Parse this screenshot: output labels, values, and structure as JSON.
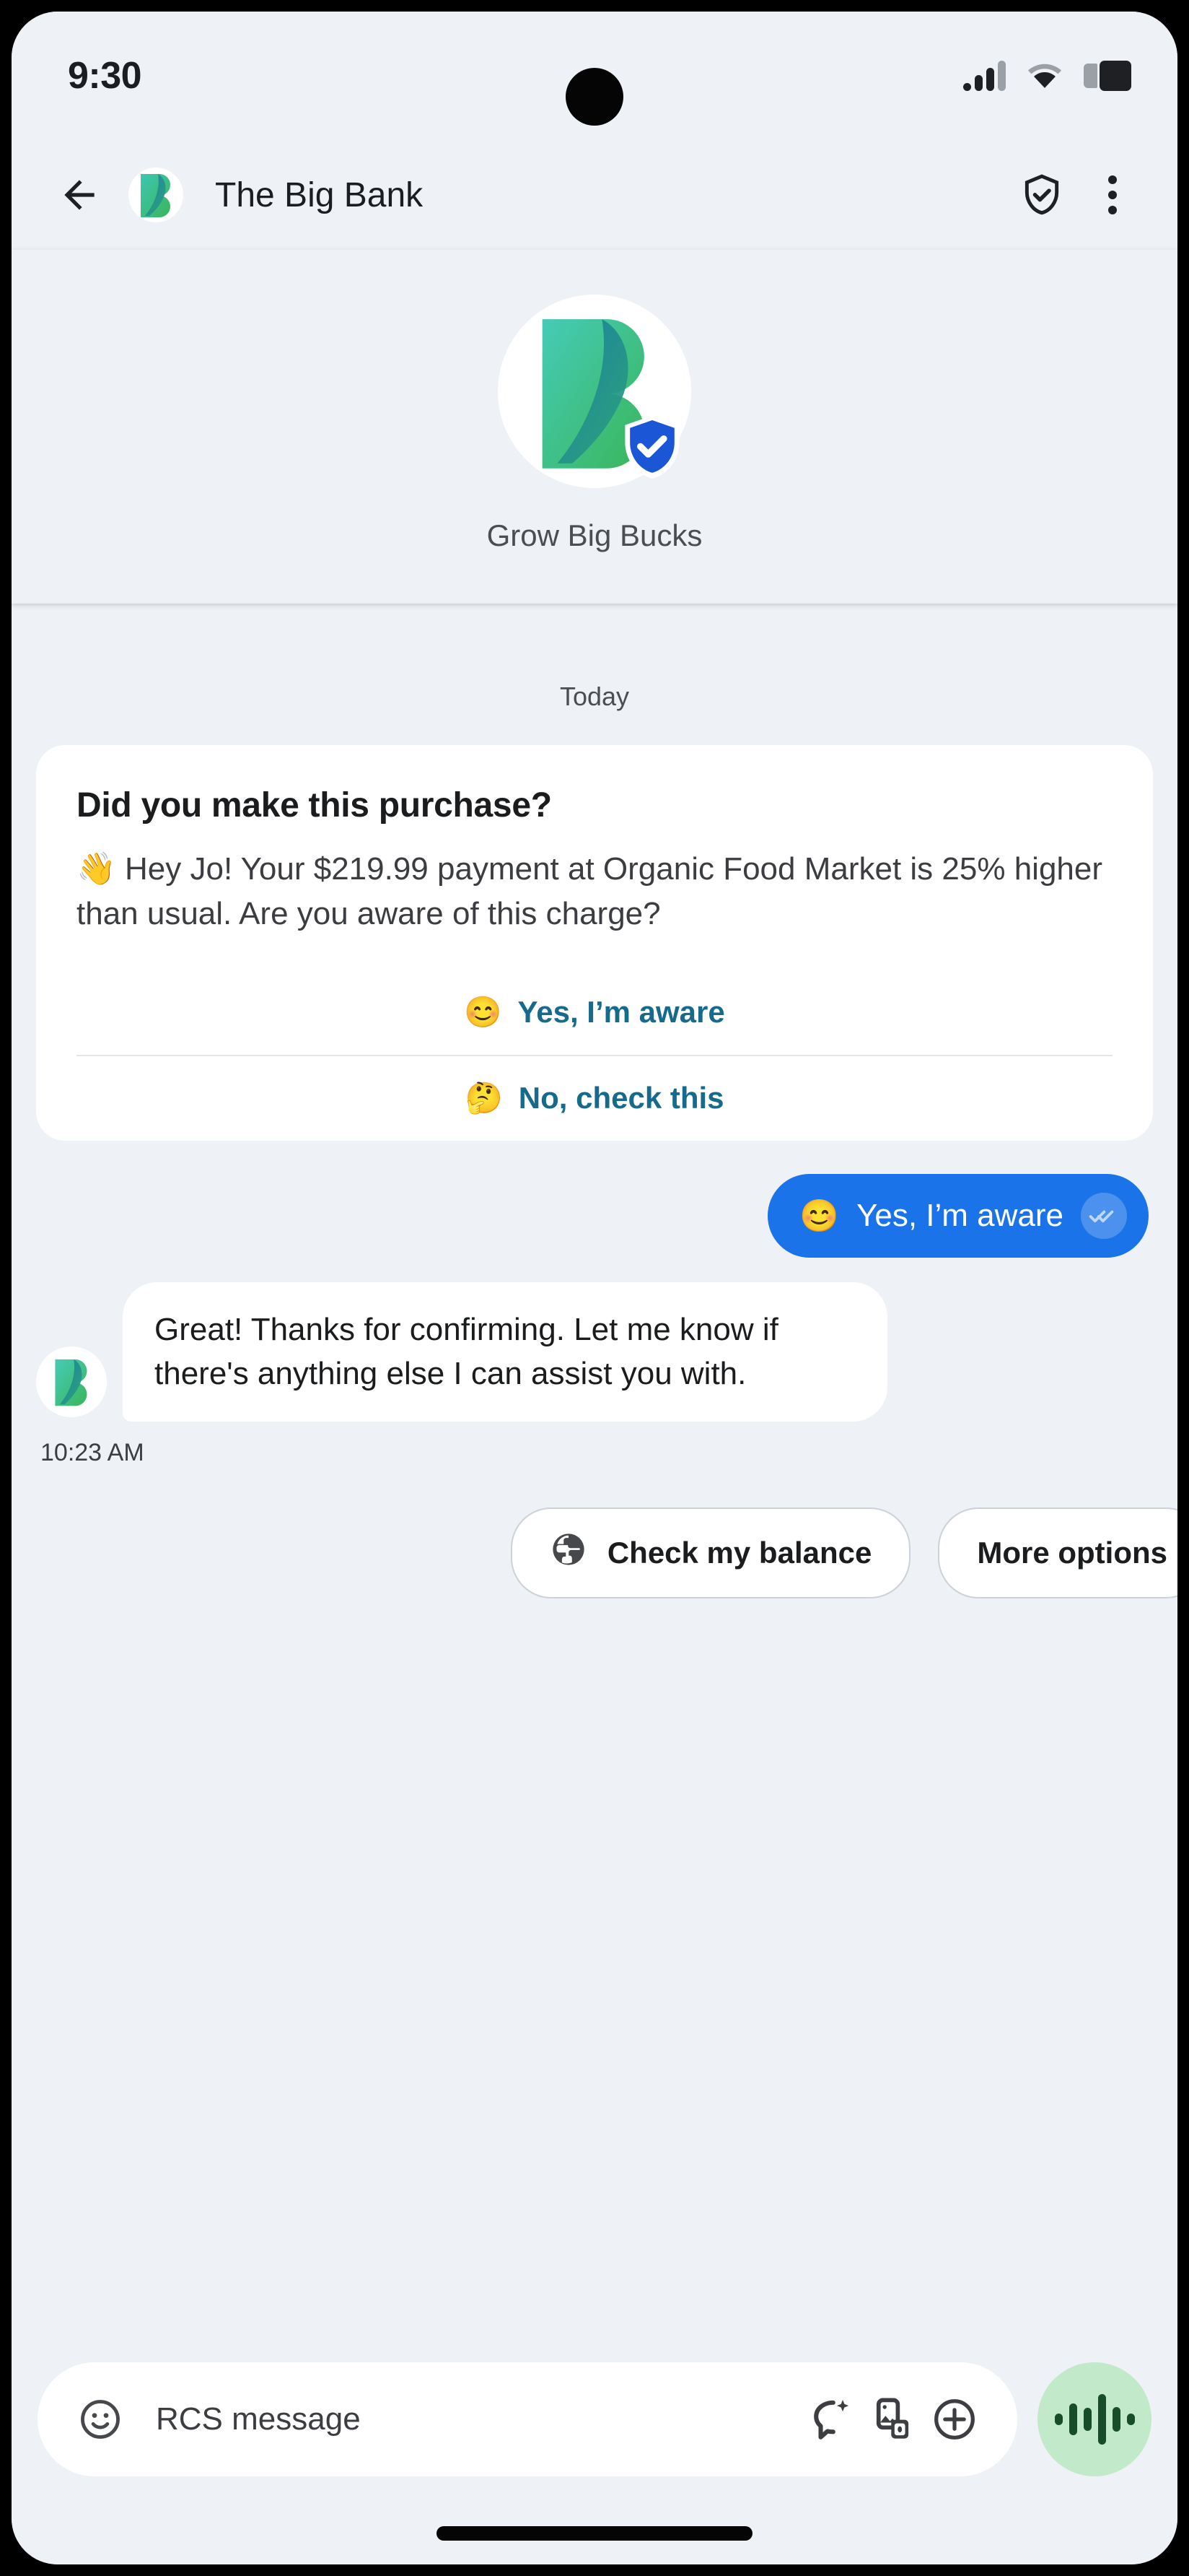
{
  "status_bar": {
    "time": "9:30",
    "signal_icon": "cellular-signal-icon",
    "wifi_icon": "wifi-icon",
    "battery_icon": "battery-icon"
  },
  "app_bar": {
    "back_icon": "back-arrow-icon",
    "title": "The Big Bank",
    "verified_icon": "verified-shield-icon",
    "overflow_icon": "more-vert-icon",
    "brand_logo_icon": "big-bank-logo-icon"
  },
  "brand_header": {
    "logo_icon": "big-bank-logo-icon",
    "verified_badge_icon": "verified-shield-badge-icon",
    "tagline": "Grow Big Bucks"
  },
  "thread": {
    "day_divider": "Today",
    "rich_card": {
      "title": "Did you make this purchase?",
      "body": "👋 Hey Jo! Your $219.99 payment at Organic Food Market is 25% higher than usual. Are you aware of this charge?",
      "actions": [
        {
          "emoji": "😊",
          "label": "Yes, I’m aware"
        },
        {
          "emoji": "🤔",
          "label": "No, check this"
        }
      ]
    },
    "outgoing_message": {
      "emoji": "😊",
      "text": "Yes, I’m aware",
      "receipt_icon": "double-check-read-icon"
    },
    "incoming_message": {
      "avatar_icon": "big-bank-logo-icon",
      "text": "Great! Thanks for confirming. Let me know if there's anything else I can assist you with.",
      "timestamp": "10:23 AM"
    },
    "suggestions": [
      {
        "icon": "globe-icon",
        "label": "Check my balance"
      },
      {
        "icon": null,
        "label": "More options"
      }
    ]
  },
  "composer": {
    "emoji_icon": "emoji-smiley-icon",
    "placeholder": "RCS message",
    "ai_suggest_icon": "sparkle-chat-icon",
    "gallery_icon": "gallery-camera-icon",
    "attach_icon": "plus-circle-icon",
    "voice_icon": "voice-waveform-icon"
  },
  "nav_bar": {
    "home_indicator": "home-gesture-pill"
  },
  "colors": {
    "page_background": "#eef1f6",
    "outgoing_bubble": "#1a73e8",
    "link_accent": "#166a8c",
    "voice_button": "#c2e9ca",
    "voice_icon": "#174d2a",
    "brand_gradient_start": "#3ec6b4",
    "brand_gradient_end": "#3ab65b",
    "verified_badge": "#1a56d6"
  }
}
